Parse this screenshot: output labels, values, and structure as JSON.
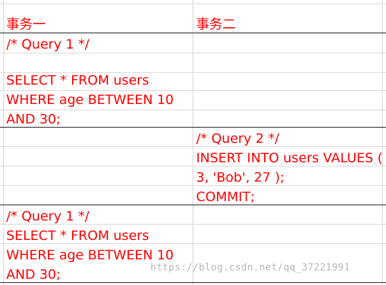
{
  "header": {
    "col1": "事务一",
    "col2": "事务二"
  },
  "transaction1_block1": {
    "comment": "/* Query 1 */",
    "lines": [
      "SELECT * FROM users",
      "WHERE age BETWEEN 10",
      "AND 30;"
    ]
  },
  "transaction2_block": {
    "comment": "/* Query 2 */",
    "lines": [
      "INSERT INTO users VALUES (",
      "3, 'Bob', 27 );",
      "COMMIT;"
    ]
  },
  "transaction1_block2": {
    "comment": "/* Query 1 */",
    "lines": [
      "SELECT * FROM users",
      "WHERE age BETWEEN 10",
      "AND 30;"
    ]
  },
  "watermark": "https://blog.csdn.net/qq_37221991",
  "colors": {
    "text": "#ff0000",
    "grid": "#d4d4d4",
    "separator": "#1a1a1a"
  }
}
